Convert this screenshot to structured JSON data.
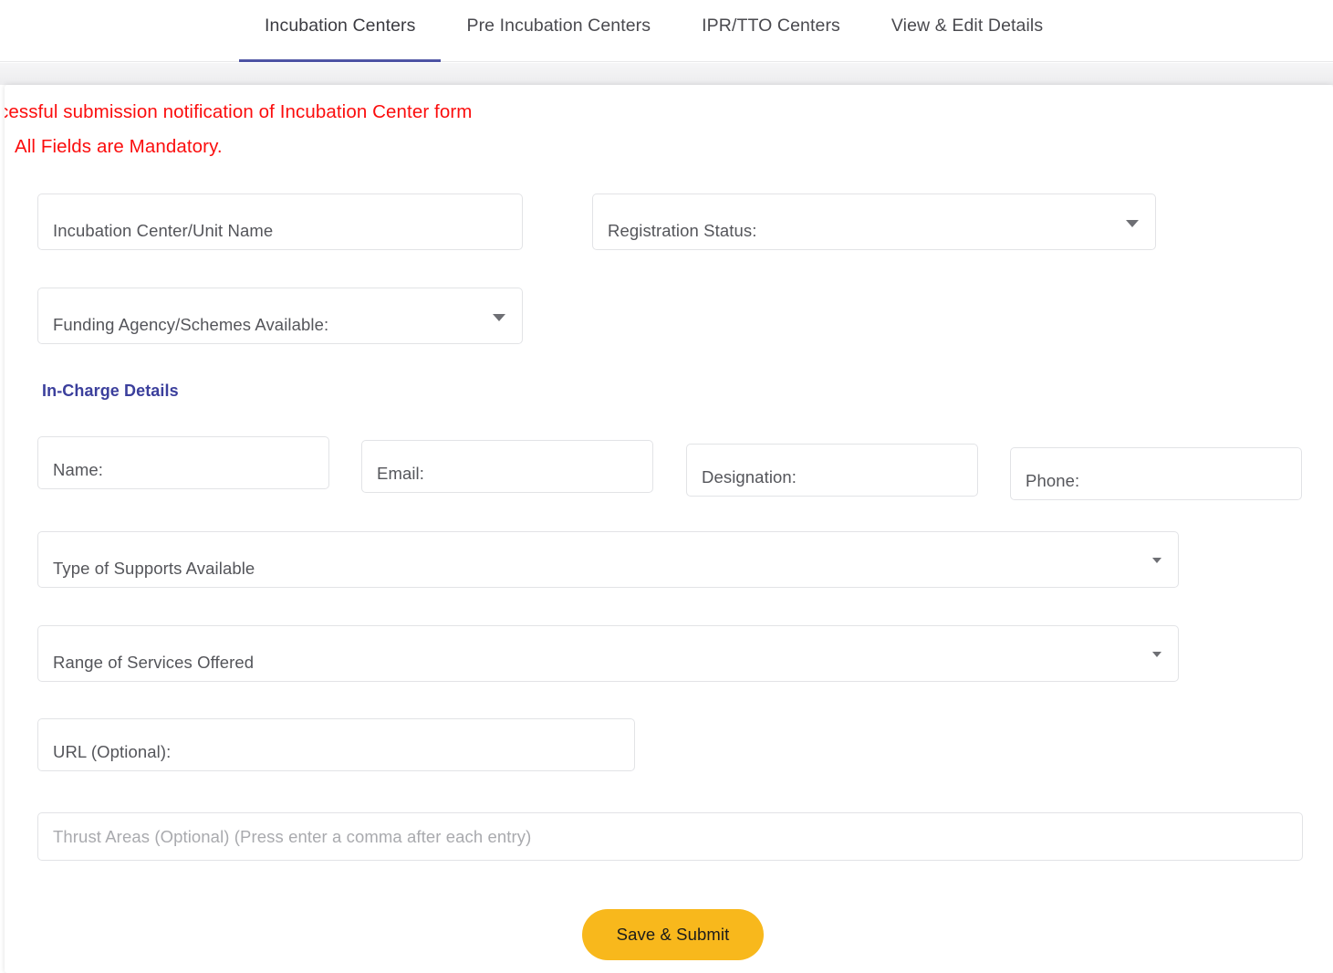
{
  "theme": {
    "accent": "#4e54a4",
    "button": "#f8b81c",
    "notice_color": "#fb0d0d",
    "section_heading_color": "#3b3f9c"
  },
  "tabs": [
    {
      "label": "Incubation Centers",
      "active": true
    },
    {
      "label": "Pre Incubation Centers",
      "active": false
    },
    {
      "label": "IPR/TTO Centers",
      "active": false
    },
    {
      "label": "View & Edit Details",
      "active": false
    }
  ],
  "notice": {
    "line1": "cessful submission notification of Incubation Center form",
    "line2": "All Fields are Mandatory."
  },
  "form": {
    "center_name": {
      "label": "Incubation Center/Unit Name",
      "value": ""
    },
    "registration_status": {
      "label": "Registration Status:",
      "value": ""
    },
    "funding_agency": {
      "label": "Funding Agency/Schemes Available:",
      "value": ""
    },
    "section_incharge": "In-Charge Details",
    "incharge": {
      "name": {
        "label": "Name:",
        "value": ""
      },
      "email": {
        "label": "Email:",
        "value": ""
      },
      "designation": {
        "label": "Designation:",
        "value": ""
      },
      "phone": {
        "label": "Phone:",
        "value": ""
      }
    },
    "type_of_supports": {
      "label": "Type of Supports Available",
      "value": ""
    },
    "range_of_services": {
      "label": "Range of Services Offered",
      "value": ""
    },
    "url": {
      "label": "URL (Optional):",
      "value": ""
    },
    "thrust_areas": {
      "placeholder": "Thrust Areas (Optional) (Press enter a comma after each entry)",
      "value": ""
    },
    "submit_label": "Save & Submit"
  },
  "icons": {
    "dropdown": "chevron-down-icon"
  }
}
